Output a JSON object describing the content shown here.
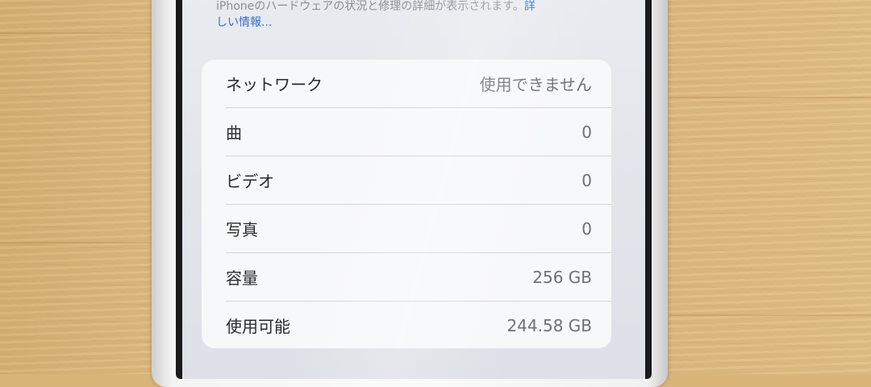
{
  "footer": {
    "text": "iPhoneのハードウェアの状況と修理の詳細が表示されます。",
    "link_part1": "詳",
    "link_part2": "しい情報..."
  },
  "about": {
    "rows": [
      {
        "label": "ネットワーク",
        "value": "使用できません"
      },
      {
        "label": "曲",
        "value": "0"
      },
      {
        "label": "ビデオ",
        "value": "0"
      },
      {
        "label": "写真",
        "value": "0"
      },
      {
        "label": "容量",
        "value": "256 GB"
      },
      {
        "label": "使用可能",
        "value": "244.58 GB"
      }
    ]
  }
}
